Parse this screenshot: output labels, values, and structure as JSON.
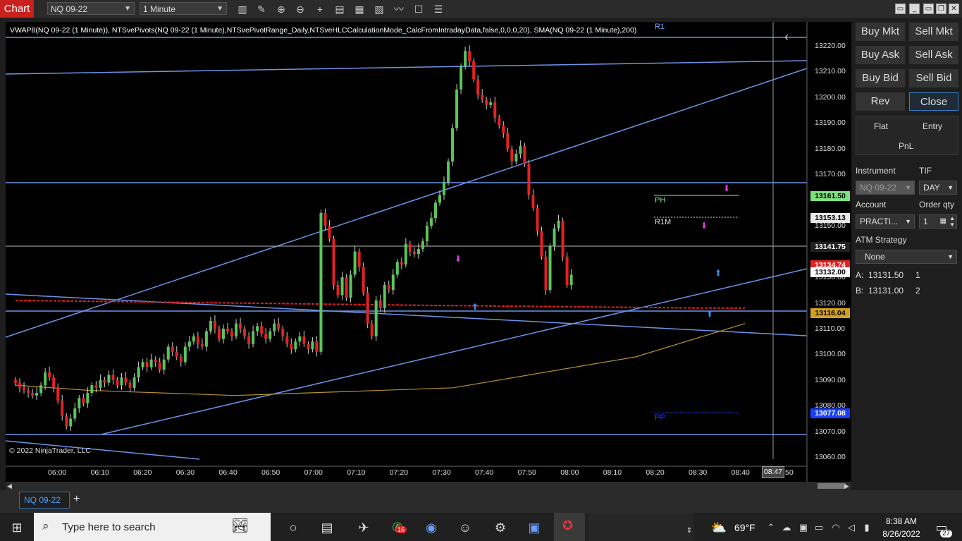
{
  "toolbar": {
    "chart_tab": "Chart",
    "instrument": "NQ 09-22",
    "interval": "1 Minute"
  },
  "chart": {
    "indicators": "VWAP8(NQ 09-22 (1 Minute)), NTSvePivots(NQ 09-22 (1 Minute),NTSvePivotRange_Daily,NTSveHLCCalculationMode_CalcFromIntradayData,false,0,0,0,20), SMA(NQ 09-22 (1 Minute),200)",
    "copyright": "© 2022 NinjaTrader, LLC",
    "pivot_labels": {
      "r1": "R1",
      "ph": "PH",
      "r1m": "R1M",
      "pp": "PP"
    },
    "cursor_time": "08:47",
    "cursor_time_suffix": "50",
    "colors": {
      "up": "#59c659",
      "down": "#e22222",
      "trendline": "#6e94e8",
      "vwap": "#e02020",
      "sma": "#b8912f"
    }
  },
  "chart_data": {
    "type": "candlestick",
    "x_ticks": [
      "06:00",
      "06:10",
      "06:20",
      "06:30",
      "06:40",
      "06:50",
      "07:00",
      "07:10",
      "07:20",
      "07:30",
      "07:40",
      "07:50",
      "08:00",
      "08:10",
      "08:20",
      "08:30",
      "08:40"
    ],
    "y_ticks": [
      "13220.00",
      "13210.00",
      "13200.00",
      "13190.00",
      "13180.00",
      "13170.00",
      "13150.00",
      "13130.00",
      "13120.00",
      "13110.00",
      "13100.00",
      "13090.00",
      "13080.00",
      "13070.00",
      "13060.00"
    ],
    "ylim": [
      13058,
      13224
    ],
    "price_badges": [
      {
        "label": "13161.50",
        "value": 13161.5,
        "bg": "#7ee07e",
        "fg": "#000"
      },
      {
        "label": "13153.13",
        "value": 13153.13,
        "bg": "#e8e8e8",
        "fg": "#000"
      },
      {
        "label": "13141.75",
        "value": 13141.75,
        "bg": "#222",
        "fg": "#fff"
      },
      {
        "label": "13134.74",
        "value": 13134.74,
        "bg": "#e22222",
        "fg": "#fff"
      },
      {
        "label": "13132.00",
        "value": 13132.0,
        "bg": "#fff",
        "fg": "#000"
      },
      {
        "label": "13116.04",
        "value": 13116.04,
        "bg": "#d4a020",
        "fg": "#000"
      },
      {
        "label": "13077.08",
        "value": 13077.08,
        "bg": "#1840ff",
        "fg": "#fff"
      }
    ],
    "closes": [
      13089,
      13087,
      13086,
      13085,
      13084,
      13085,
      13088,
      13093,
      13091,
      13087,
      13082,
      13076,
      13072,
      13075,
      13079,
      13083,
      13081,
      13085,
      13088,
      13087,
      13090,
      13089,
      13092,
      13090,
      13088,
      13091,
      13089,
      13087,
      13091,
      13095,
      13097,
      13095,
      13098,
      13097,
      13094,
      13098,
      13103,
      13101,
      13099,
      13097,
      13103,
      13105,
      13107,
      13104,
      13103,
      13109,
      13113,
      13110,
      13106,
      13110,
      13109,
      13107,
      13112,
      13110,
      13107,
      13104,
      13109,
      13111,
      13108,
      13106,
      13109,
      13112,
      13110,
      13107,
      13104,
      13102,
      13105,
      13107,
      13104,
      13102,
      13105,
      13101,
      13155,
      13150,
      13145,
      13127,
      13123,
      13130,
      13122,
      13131,
      13140,
      13134,
      13124,
      13112,
      13107,
      13121,
      13118,
      13127,
      13125,
      13131,
      13136,
      13135,
      13143,
      13140,
      13139,
      13141,
      13144,
      13150,
      13153,
      13159,
      13162,
      13167,
      13175,
      13188,
      13203,
      13212,
      13218,
      13214,
      13207,
      13201,
      13199,
      13197,
      13198,
      13192,
      13189,
      13186,
      13180,
      13175,
      13178,
      13181,
      13174,
      13162,
      13157,
      13148,
      13138,
      13125,
      13142,
      13149,
      13152,
      13138,
      13127,
      13131
    ],
    "vwap_line": [
      [
        13121,
        0
      ],
      [
        13119,
        58
      ],
      [
        13118,
        95
      ],
      [
        13118,
        100
      ]
    ],
    "sma_line": [
      [
        13088,
        0
      ],
      [
        13086,
        10
      ],
      [
        13084,
        30
      ],
      [
        13087,
        60
      ],
      [
        13099,
        85
      ],
      [
        13112,
        100
      ]
    ]
  },
  "panel": {
    "buttons": [
      "Buy Mkt",
      "Sell Mkt",
      "Buy Ask",
      "Sell Ask",
      "Buy Bid",
      "Sell Bid",
      "Rev",
      "Close"
    ],
    "flat": "Flat",
    "entry": "Entry",
    "pnl": "PnL",
    "instrument_label": "Instrument",
    "tif_label": "TIF",
    "instrument_value": "NQ 09-22",
    "tif_value": "DAY",
    "account_label": "Account",
    "order_qty_label": "Order qty",
    "account_value": "PRACTI...",
    "order_qty_value": "1",
    "atm_label": "ATM Strategy",
    "atm_value": "None",
    "ask_prefix": "A:",
    "ask_price": "13131.50",
    "ask_qty": "1",
    "bid_prefix": "B:",
    "bid_price": "13131.00",
    "bid_qty": "2"
  },
  "tabs": {
    "active": "NQ 09-22",
    "add": "+"
  },
  "taskbar": {
    "search_placeholder": "Type here to search",
    "whatsapp_badge": "16",
    "weather": "69°F",
    "time": "8:38 AM",
    "date": "8/26/2022",
    "notifications": "27"
  }
}
